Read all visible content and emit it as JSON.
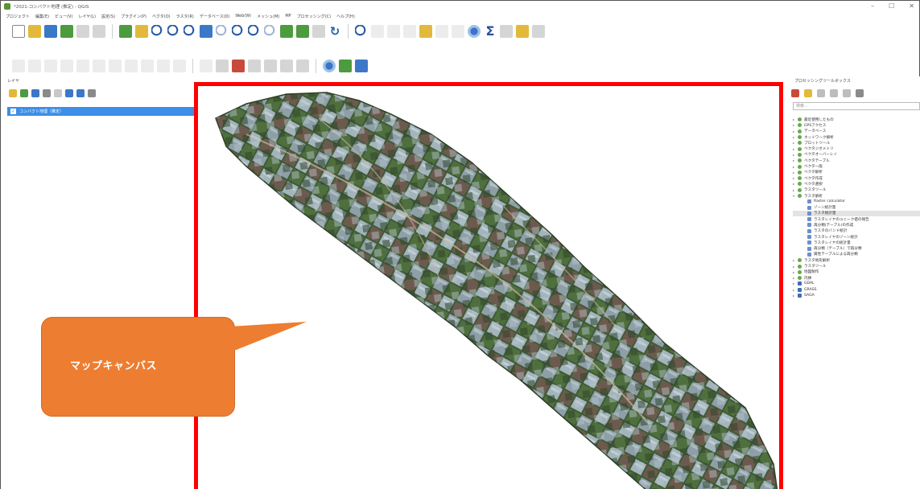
{
  "window": {
    "title": "*2021-コンバクト地理 (推定) - QGIS",
    "controls": [
      "–",
      "☐",
      "✕"
    ]
  },
  "menubar": {
    "items": [
      "プロジェクト",
      "編集(E)",
      "ビュー(V)",
      "レイヤ(L)",
      "設定(S)",
      "プラグイン(P)",
      "ベクタ(O)",
      "ラスタ(R)",
      "データベース(D)",
      "Web(W)",
      "メッシュ(M)",
      "MP",
      "プロセッシング(C)",
      "ヘルプ(H)"
    ]
  },
  "layers_panel": {
    "title": "レイヤ",
    "layer_name": "コンバクト地理（推定）"
  },
  "map": {
    "callout_text": "マップキャンバス",
    "frame_color": "#ff0000",
    "callout_color": "#ed7d31"
  },
  "toolbox": {
    "title": "プロセッシングツールボックス",
    "search_placeholder": "検索...",
    "tree": [
      {
        "label": "最近使用したもの",
        "level": 0,
        "icon": "clock-icon"
      },
      {
        "label": "GPSアクセス",
        "level": 0,
        "icon": "qgis-icon"
      },
      {
        "label": "データベース",
        "level": 0,
        "icon": "qgis-icon"
      },
      {
        "label": "ネットワーク解析",
        "level": 0,
        "icon": "qgis-icon"
      },
      {
        "label": "プロットツール",
        "level": 0,
        "icon": "qgis-icon"
      },
      {
        "label": "ベクタジオメトリ",
        "level": 0,
        "icon": "qgis-icon"
      },
      {
        "label": "ベクタオーバーレイ",
        "level": 0,
        "icon": "qgis-icon"
      },
      {
        "label": "ベクタテーブル",
        "level": 0,
        "icon": "qgis-icon"
      },
      {
        "label": "ベクタ一般",
        "level": 0,
        "icon": "qgis-icon"
      },
      {
        "label": "ベクタ解析",
        "level": 0,
        "icon": "qgis-icon"
      },
      {
        "label": "ベクタ作成",
        "level": 0,
        "icon": "qgis-icon"
      },
      {
        "label": "ベクタ選択",
        "level": 0,
        "icon": "qgis-icon"
      },
      {
        "label": "ラスタツール",
        "level": 0,
        "icon": "qgis-icon"
      },
      {
        "label": "ラスタ解析",
        "level": 0,
        "icon": "qgis-icon",
        "expanded": true
      },
      {
        "label": "Raster calculator",
        "level": 1,
        "icon": "algorithm-icon"
      },
      {
        "label": "ゾーン統計量",
        "level": 1,
        "icon": "algorithm-icon"
      },
      {
        "label": "ラスタ統計量",
        "level": 1,
        "icon": "algorithm-icon",
        "selected": true
      },
      {
        "label": "ラスタレイヤのユニーク値の報告",
        "level": 1,
        "icon": "algorithm-icon"
      },
      {
        "label": "再分類(テーブル)の作成",
        "level": 1,
        "icon": "algorithm-icon"
      },
      {
        "label": "ラスタのバンド統計",
        "level": 1,
        "icon": "algorithm-icon"
      },
      {
        "label": "ラスタレイヤのゾーン統計",
        "level": 1,
        "icon": "algorithm-icon"
      },
      {
        "label": "ラスタレイヤの統計量",
        "level": 1,
        "icon": "algorithm-icon"
      },
      {
        "label": "再分類（テーブル）で再分類",
        "level": 1,
        "icon": "algorithm-icon"
      },
      {
        "label": "属性テーブルによる再分類",
        "level": 1,
        "icon": "algorithm-icon"
      },
      {
        "label": "ラスタ地形解析",
        "level": 0,
        "icon": "qgis-icon"
      },
      {
        "label": "ラスタツール",
        "level": 0,
        "icon": "qgis-icon"
      },
      {
        "label": "地図製作",
        "level": 0,
        "icon": "qgis-icon"
      },
      {
        "label": "内挿",
        "level": 0,
        "icon": "qgis-icon"
      },
      {
        "label": "GDAL",
        "level": 0,
        "icon": "gdal-icon"
      },
      {
        "label": "GRASS",
        "level": 0,
        "icon": "grass-icon"
      },
      {
        "label": "SAGA",
        "level": 0,
        "icon": "saga-icon"
      }
    ]
  }
}
